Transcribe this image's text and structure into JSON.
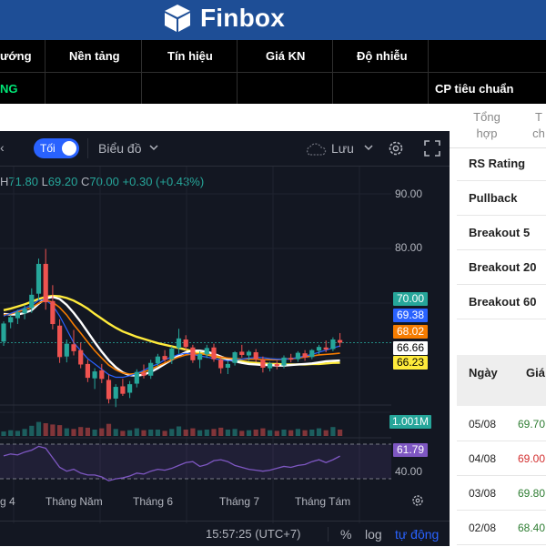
{
  "header": {
    "brand": "Finbox"
  },
  "topbar": {
    "columns": [
      "ướng",
      "Nền tảng",
      "Tín hiệu",
      "Giá KN",
      "Độ nhiễu"
    ],
    "row_value": "NG",
    "cp_label": "CP tiêu chuẩn"
  },
  "chart": {
    "toggle_label": "Tối",
    "chart_type_label": "Biểu đồ",
    "save_label": "Lưu",
    "ohlc": {
      "h_key": "H",
      "h": "71.80",
      "l_key": "L",
      "l": "69.20",
      "c_key": "C",
      "c": "70.00",
      "change": "+0.30 (+0.43%)"
    },
    "y_axis": [
      "90.00",
      "80.00"
    ],
    "price_tags": [
      {
        "value": "70.00",
        "color": "#26a69a"
      },
      {
        "value": "69.38",
        "color": "#2962ff"
      },
      {
        "value": "68.02",
        "color": "#f57c00"
      },
      {
        "value": "66.66",
        "color": "#ffffff"
      },
      {
        "value": "66.23",
        "color": "#ffeb3b"
      }
    ],
    "volume_tag": "1.001M",
    "rsi_tag": "61.79",
    "rsi_axis": "40.00",
    "time_axis": [
      "g 4",
      "Tháng Năm",
      "Tháng 6",
      "Tháng 7",
      "Tháng Tám"
    ],
    "time": "15:57:25 (UTC+7)",
    "percent_label": "%",
    "log_label": "log",
    "auto_label": "tự động",
    "candles": [
      [
        70.2,
        74.0,
        69.4,
        73.6
      ],
      [
        73.8,
        75.2,
        72.7,
        74.8
      ],
      [
        74.6,
        76.2,
        73.5,
        75.7
      ],
      [
        75.5,
        77.1,
        74.4,
        76.4
      ],
      [
        76.5,
        80.2,
        75.6,
        79.0
      ],
      [
        79.2,
        85.8,
        78.0,
        84.8
      ],
      [
        84.8,
        87.6,
        76.2,
        77.6
      ],
      [
        77.8,
        80.8,
        72.5,
        73.5
      ],
      [
        73.2,
        74.4,
        66.2,
        67.3
      ],
      [
        67.4,
        70.6,
        66.3,
        69.8
      ],
      [
        69.7,
        72.4,
        67.6,
        68.4
      ],
      [
        68.6,
        70.0,
        65.2,
        65.9
      ],
      [
        66.0,
        66.8,
        62.6,
        63.4
      ],
      [
        63.3,
        65.2,
        61.3,
        64.6
      ],
      [
        64.8,
        66.0,
        62.4,
        63.2
      ],
      [
        63.0,
        64.0,
        58.6,
        59.4
      ],
      [
        59.5,
        62.2,
        57.9,
        61.7
      ],
      [
        61.8,
        63.2,
        60.0,
        60.4
      ],
      [
        60.6,
        62.8,
        59.6,
        62.2
      ],
      [
        62.3,
        65.0,
        61.6,
        64.5
      ],
      [
        64.4,
        65.9,
        63.3,
        63.8
      ],
      [
        63.8,
        66.8,
        63.2,
        66.2
      ],
      [
        66.1,
        67.9,
        65.5,
        67.4
      ],
      [
        67.5,
        68.6,
        66.4,
        66.8
      ],
      [
        66.9,
        69.3,
        66.0,
        68.9
      ],
      [
        69.0,
        72.6,
        67.9,
        70.8
      ],
      [
        70.6,
        71.4,
        68.6,
        69.2
      ],
      [
        69.1,
        69.6,
        66.2,
        66.7
      ],
      [
        66.8,
        68.4,
        65.2,
        67.9
      ],
      [
        67.8,
        69.6,
        67.1,
        69.0
      ],
      [
        69.1,
        69.8,
        66.4,
        66.9
      ],
      [
        66.8,
        67.4,
        64.2,
        65.2
      ],
      [
        65.3,
        66.6,
        64.1,
        66.0
      ],
      [
        66.2,
        68.4,
        65.7,
        68.2
      ],
      [
        68.3,
        69.6,
        67.2,
        67.7
      ],
      [
        67.6,
        68.6,
        66.6,
        68.3
      ],
      [
        68.2,
        68.8,
        66.4,
        66.9
      ],
      [
        66.8,
        67.4,
        64.4,
        65.3
      ],
      [
        65.2,
        66.4,
        64.6,
        66.1
      ],
      [
        66.0,
        66.6,
        65.0,
        65.6
      ],
      [
        65.7,
        67.6,
        65.2,
        67.2
      ],
      [
        67.1,
        67.9,
        66.3,
        66.8
      ],
      [
        66.9,
        68.4,
        66.4,
        68.1
      ],
      [
        68.0,
        68.6,
        66.6,
        67.2
      ],
      [
        67.3,
        68.8,
        66.9,
        68.6
      ],
      [
        68.5,
        69.6,
        67.8,
        69.2
      ],
      [
        69.1,
        70.4,
        68.2,
        68.7
      ],
      [
        68.8,
        71.0,
        68.4,
        70.6
      ],
      [
        70.5,
        71.8,
        69.2,
        70.0
      ]
    ],
    "ma_blue": [
      75,
      75.5,
      76,
      76.5,
      77,
      78,
      78,
      77,
      75,
      72.5,
      70,
      68.5,
      67,
      66,
      65,
      64,
      63.5,
      63.5,
      63.8,
      64.2,
      64.8,
      65.5,
      66,
      66.8,
      67.3,
      67.8,
      68,
      67.8,
      67.5,
      67.3,
      67,
      66.8,
      66.6,
      66.7,
      66.9,
      67.1,
      67.2,
      67.2,
      67,
      66.9,
      66.9,
      67,
      67.2,
      67.5,
      67.8,
      68.2,
      68.6,
      69,
      69.38
    ],
    "ma_orange": [
      75.2,
      75.4,
      75.8,
      76.2,
      76.6,
      77.4,
      78,
      77.6,
      76.6,
      75.2,
      73.4,
      71.8,
      70.1,
      68.5,
      67.1,
      65.8,
      64.9,
      64.3,
      64.1,
      64.2,
      64.5,
      65,
      65.6,
      66.2,
      66.8,
      67.3,
      67.7,
      67.9,
      67.9,
      67.8,
      67.6,
      67.3,
      67.1,
      67,
      66.9,
      66.9,
      66.9,
      66.8,
      66.8,
      66.8,
      66.9,
      67,
      67.1,
      67.3,
      67.5,
      67.7,
      67.8,
      67.9,
      68.02
    ],
    "ma_white": [
      75.4,
      75.3,
      75.3,
      75.6,
      76.1,
      77.3,
      78.3,
      78.6,
      78.2,
      77.1,
      75.6,
      73.9,
      72,
      70.1,
      68.3,
      66.7,
      65.4,
      64.4,
      63.9,
      63.8,
      64,
      64.5,
      65.2,
      66,
      66.8,
      67.6,
      68.2,
      68.5,
      68.5,
      68.3,
      67.9,
      67.4,
      66.9,
      66.5,
      66.2,
      66,
      65.9,
      65.8,
      65.8,
      65.7,
      65.7,
      65.8,
      65.9,
      66,
      66.1,
      66.3,
      66.5,
      66.6,
      66.66
    ],
    "ma_yellow": [
      76.1,
      76.4,
      76.8,
      77.2,
      77.7,
      78.2,
      78.6,
      78.8,
      78.7,
      78.4,
      77.9,
      77.2,
      76.4,
      75.4,
      74.5,
      73.6,
      72.8,
      72.1,
      71.6,
      71.1,
      70.7,
      70.3,
      69.9,
      69.6,
      69.3,
      69,
      68.7,
      68.4,
      68.1,
      67.8,
      67.5,
      67.2,
      66.9,
      66.7,
      66.5,
      66.3,
      66.2,
      66.1,
      66,
      66,
      65.9,
      65.9,
      65.9,
      65.9,
      66,
      66,
      66.1,
      66.2,
      66.23
    ],
    "volume": [
      0.7,
      0.9,
      0.8,
      1.1,
      1.6,
      2.2,
      2.0,
      1.8,
      1.7,
      1.2,
      1.1,
      1.4,
      1.3,
      1.0,
      1.2,
      1.9,
      1.1,
      0.8,
      0.9,
      1.2,
      0.9,
      1.0,
      1.0,
      0.8,
      1.1,
      1.5,
      1.0,
      1.2,
      0.9,
      1.0,
      1.1,
      1.3,
      1.0,
      1.1,
      0.8,
      0.9,
      1.0,
      1.2,
      0.9,
      0.8,
      1.0,
      0.9,
      1.1,
      0.9,
      1.0,
      1.2,
      0.9,
      1.4,
      1.0
    ],
    "rsi": [
      62,
      64,
      63,
      66,
      68,
      72,
      70,
      60,
      50,
      46,
      48,
      44,
      42,
      42,
      40,
      36,
      38,
      39,
      41,
      44,
      43,
      46,
      48,
      47,
      49,
      52,
      55,
      56,
      51,
      53,
      57,
      58,
      56,
      52,
      50,
      48,
      47,
      46,
      47,
      49,
      51,
      50,
      52,
      53,
      56,
      58,
      55,
      58,
      61.79
    ]
  },
  "side": {
    "tabs": [
      "Tổng hợp",
      "T ch"
    ],
    "rs_rows": [
      "RS Rating",
      "Pullback",
      "Breakout 5",
      "Breakout 20",
      "Breakout 60"
    ],
    "table_headers": [
      "Ngày",
      "Giá"
    ],
    "rows": [
      {
        "date": "05/08",
        "price": "69.70",
        "color": "#2e7d32"
      },
      {
        "date": "04/08",
        "price": "69.00",
        "color": "#d32f2f"
      },
      {
        "date": "03/08",
        "price": "69.80",
        "color": "#2e7d32"
      },
      {
        "date": "02/08",
        "price": "68.40",
        "color": "#2e7d32"
      }
    ]
  }
}
